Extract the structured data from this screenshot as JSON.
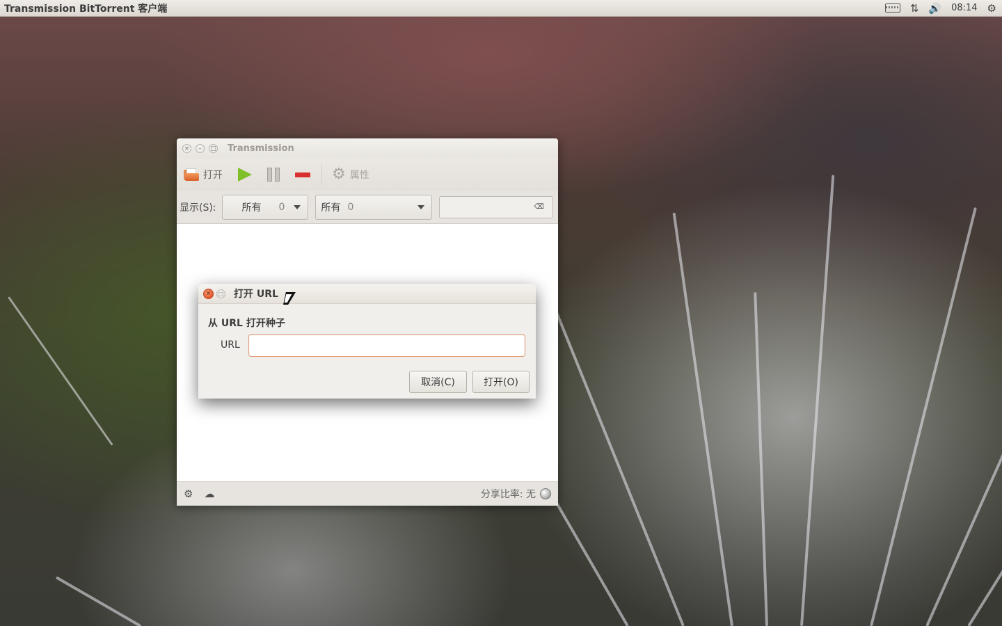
{
  "top_panel": {
    "app_title": "Transmission BitTorrent 客户端",
    "time": "08:14",
    "icons": [
      "keyboard-icon",
      "network-transfer-icon",
      "volume-icon",
      "power-gear-icon"
    ]
  },
  "main_window": {
    "title": "Transmission",
    "toolbar": {
      "open_label": "打开",
      "properties_label": "属性"
    },
    "filter": {
      "show_label": "显示(S):",
      "activity_combo": {
        "text": "所有",
        "count": "0"
      },
      "tracker_combo": {
        "text": "所有",
        "count": "0"
      },
      "search_value": ""
    },
    "status": {
      "ratio_label": "分享比率: 无"
    }
  },
  "dialog": {
    "title": "打开 URL",
    "heading": "从 URL 打开种子",
    "url_label": "URL",
    "url_value": "",
    "cancel_label": "取消(C)",
    "open_label": "打开(O)"
  },
  "colors": {
    "accent_play": "#7fbf2a",
    "accent_remove": "#d92f2f",
    "dialog_close": "#e2562a",
    "input_focus_border": "#e59a76"
  }
}
